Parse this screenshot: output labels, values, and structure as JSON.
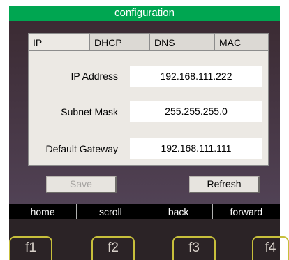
{
  "window": {
    "title": "configuration"
  },
  "tabs": [
    {
      "label": "IP",
      "active": true
    },
    {
      "label": "DHCP",
      "active": false
    },
    {
      "label": "DNS",
      "active": false
    },
    {
      "label": "MAC",
      "active": false
    }
  ],
  "ip_settings": {
    "ip_address": {
      "label": "IP Address",
      "value": "192.168.111.222"
    },
    "subnet_mask": {
      "label": "Subnet Mask",
      "value": "255.255.255.0"
    },
    "default_gateway": {
      "label": "Default Gateway",
      "value": "192.168.111.111"
    }
  },
  "buttons": {
    "save": {
      "label": "Save",
      "enabled": false
    },
    "refresh": {
      "label": "Refresh",
      "enabled": true
    }
  },
  "nav": {
    "home": "home",
    "scroll": "scroll",
    "back": "back",
    "forward": "forward"
  },
  "function_keys": {
    "f1": "f1",
    "f2": "f2",
    "f3": "f3",
    "f4": "f4"
  },
  "colors": {
    "title_bar": "#00a651",
    "function_key_border": "#c7bf3b",
    "panel_bg": "#ece9e4"
  }
}
